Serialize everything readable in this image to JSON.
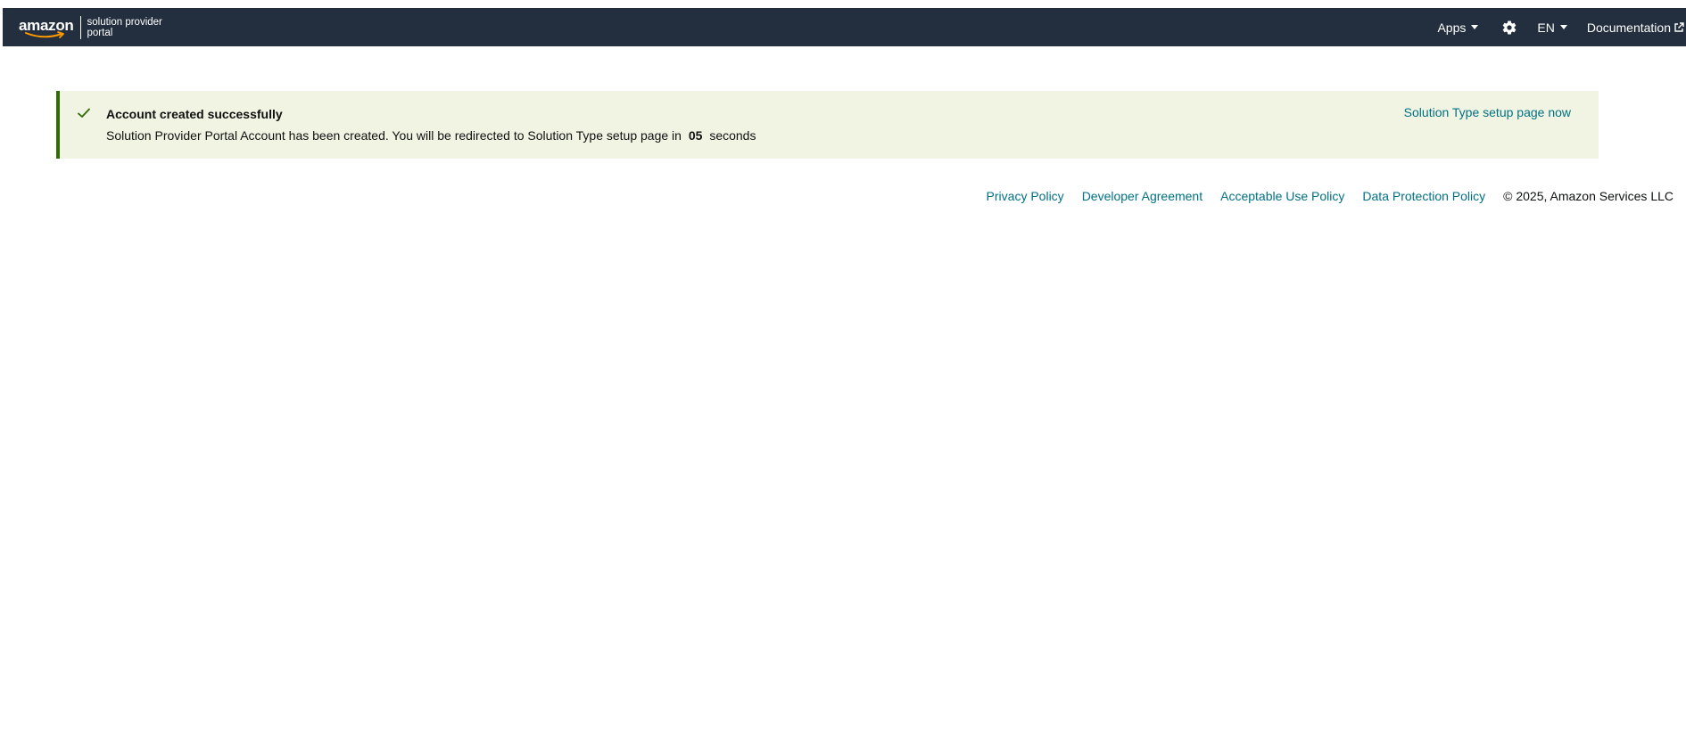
{
  "header": {
    "brand_word": "amazon",
    "brand_subtitle_line1": "solution provider",
    "brand_subtitle_line2": "portal",
    "apps_label": "Apps",
    "settings_icon": "gear-icon",
    "language_label": "EN",
    "documentation_label": "Documentation",
    "background_color": "#232f3e",
    "smile_color": "#ff9900"
  },
  "alert": {
    "icon": "check-icon",
    "title": "Account created successfully",
    "message_prefix": "Solution Provider Portal Account has been created. You will be redirected to Solution Type setup page in",
    "countdown": "05",
    "message_suffix": "seconds",
    "action_link": "Solution Type setup page now",
    "background_color": "#f1f4e2",
    "accent_color": "#2e6b00"
  },
  "footer": {
    "links": [
      "Privacy Policy",
      "Developer Agreement",
      "Acceptable Use Policy",
      "Data Protection Policy"
    ],
    "copyright": "© 2025, Amazon Services LLC",
    "link_color": "#007185"
  }
}
